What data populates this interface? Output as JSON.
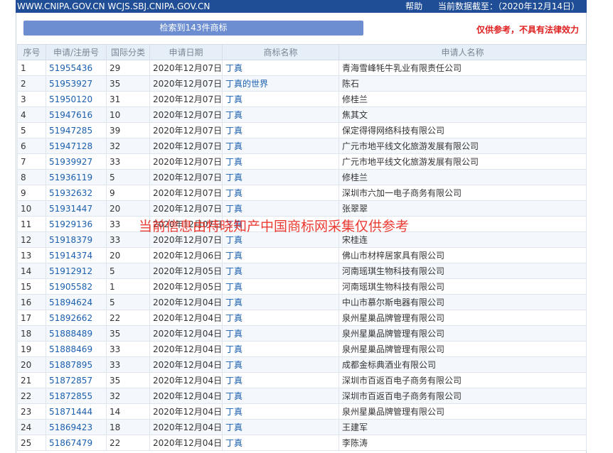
{
  "header": {
    "urls": "WWW.CNIPA.GOV.CN WCJS.SBJ.CNIPA.GOV.CN",
    "help": "帮助",
    "data_date": "当前数据截至：（2020年12月14日）"
  },
  "result_bar": "检索到143件商标",
  "disclaimer": "仅供参考，不具有法律效力",
  "watermark": "当前信息由特晓知产中国商标网采集仅供参考",
  "colors": {
    "topbar": "#1f4e96",
    "result_bar": "#6d8fd1",
    "disclaimer": "#e02020",
    "link": "#1b5fae"
  },
  "table": {
    "headers": [
      "序号",
      "申请/注册号",
      "国际分类",
      "申请日期",
      "商标名称",
      "申请人名称"
    ],
    "rows": [
      [
        "1",
        "51955436",
        "29",
        "2020年12月07日",
        "丁真",
        "青海雪峰牦牛乳业有限责任公司"
      ],
      [
        "2",
        "51953927",
        "35",
        "2020年12月07日",
        "丁真的世界",
        "陈石"
      ],
      [
        "3",
        "51950120",
        "31",
        "2020年12月07日",
        "丁真",
        "修桂兰"
      ],
      [
        "4",
        "51947616",
        "10",
        "2020年12月07日",
        "丁真",
        "焦其文"
      ],
      [
        "5",
        "51947285",
        "39",
        "2020年12月07日",
        "丁真",
        "保定得得网络科技有限公司"
      ],
      [
        "6",
        "51947128",
        "32",
        "2020年12月07日",
        "丁真",
        "广元市地平线文化旅游发展有限公司"
      ],
      [
        "7",
        "51939927",
        "33",
        "2020年12月07日",
        "丁真",
        "广元市地平线文化旅游发展有限公司"
      ],
      [
        "8",
        "51936119",
        "5",
        "2020年12月07日",
        "丁真",
        "修桂兰"
      ],
      [
        "9",
        "51932632",
        "9",
        "2020年12月07日",
        "丁真",
        "深圳市六加一电子商务有限公司"
      ],
      [
        "10",
        "51931447",
        "20",
        "2020年12月07日",
        "丁真",
        "张翠翠"
      ],
      [
        "11",
        "51929136",
        "33",
        "2020年12月07日",
        "丁真",
        ""
      ],
      [
        "12",
        "51918379",
        "33",
        "2020年12月07日",
        "丁真",
        "宋桂连"
      ],
      [
        "13",
        "51914374",
        "20",
        "2020年12月06日",
        "丁真",
        "佛山市材梓居家具有限公司"
      ],
      [
        "14",
        "51912912",
        "5",
        "2020年12月05日",
        "丁真",
        "河南瑶琪生物科技有限公司"
      ],
      [
        "15",
        "51905582",
        "1",
        "2020年12月05日",
        "丁真",
        "河南瑶琪生物科技有限公司"
      ],
      [
        "16",
        "51894624",
        "5",
        "2020年12月04日",
        "丁真",
        "中山市慕尔斯电器有限公司"
      ],
      [
        "17",
        "51892662",
        "22",
        "2020年12月04日",
        "丁真",
        "泉州星巢品牌管理有限公司"
      ],
      [
        "18",
        "51888489",
        "35",
        "2020年12月04日",
        "丁真",
        "泉州星巢品牌管理有限公司"
      ],
      [
        "19",
        "51888469",
        "33",
        "2020年12月04日",
        "丁真",
        "泉州星巢品牌管理有限公司"
      ],
      [
        "20",
        "51887895",
        "33",
        "2020年12月04日",
        "丁真",
        "成都金标典酒业有限公司"
      ],
      [
        "21",
        "51872857",
        "35",
        "2020年12月04日",
        "丁真",
        "深圳市百返百电子商务有限公司"
      ],
      [
        "22",
        "51872855",
        "32",
        "2020年12月04日",
        "丁真",
        "深圳市百返百电子商务有限公司"
      ],
      [
        "23",
        "51871444",
        "14",
        "2020年12月04日",
        "丁真",
        "泉州星巢品牌管理有限公司"
      ],
      [
        "24",
        "51869423",
        "18",
        "2020年12月04日",
        "丁真",
        "王建军"
      ],
      [
        "25",
        "51867479",
        "22",
        "2020年12月04日",
        "丁真",
        "李陈涛"
      ]
    ]
  }
}
